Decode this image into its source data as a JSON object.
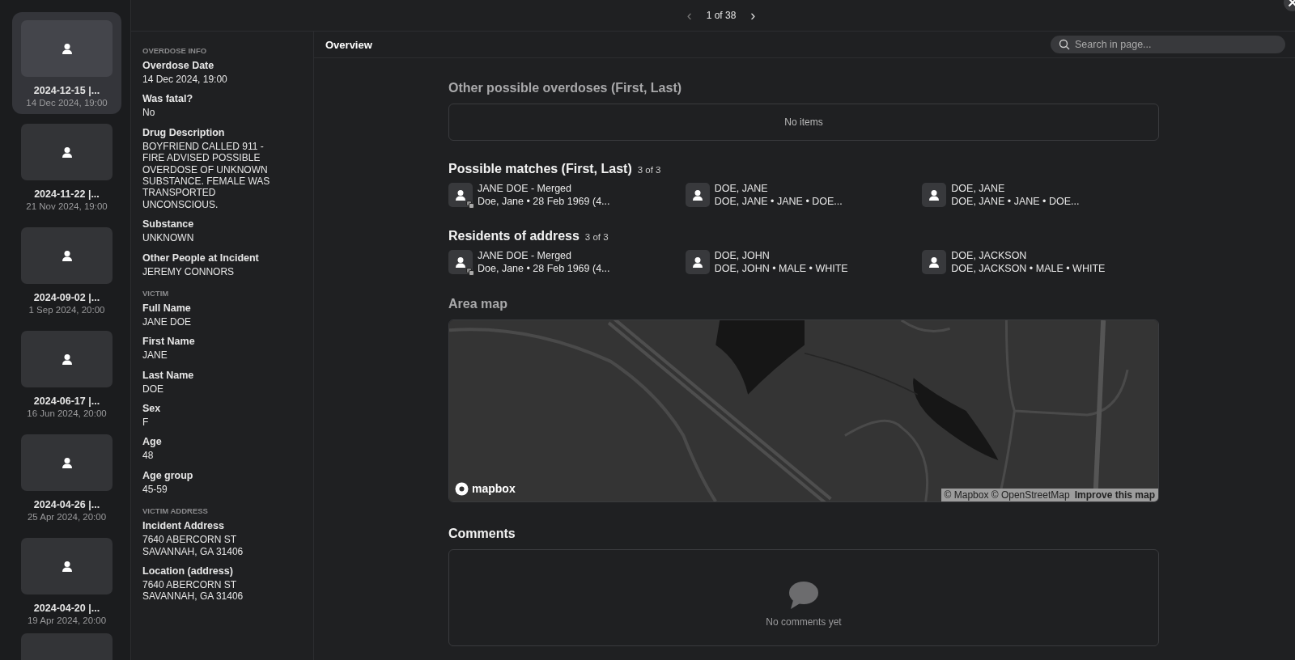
{
  "thumbnails": [
    {
      "title": "2024-12-15 |...",
      "subtitle": "14 Dec 2024, 19:00",
      "selected": true
    },
    {
      "title": "2024-11-22 |...",
      "subtitle": "21 Nov 2024, 19:00",
      "selected": false
    },
    {
      "title": "2024-09-02 |...",
      "subtitle": "1 Sep 2024, 20:00",
      "selected": false
    },
    {
      "title": "2024-06-17 |...",
      "subtitle": "16 Jun 2024, 20:00",
      "selected": false
    },
    {
      "title": "2024-04-26 |...",
      "subtitle": "25 Apr 2024, 20:00",
      "selected": false
    },
    {
      "title": "2024-04-20 |...",
      "subtitle": "19 Apr 2024, 20:00",
      "selected": false
    },
    {
      "kind": "partial"
    }
  ],
  "pager": {
    "prev": "‹",
    "text": "1 of 38",
    "next": "›"
  },
  "details": [
    {
      "section": "OVERDOSE INFO",
      "fields": [
        {
          "label": "Overdose Date",
          "value": "14 Dec 2024, 19:00"
        },
        {
          "label": "Was fatal?",
          "value": "No"
        },
        {
          "label": "Drug Description",
          "value": "BOYFRIEND CALLED 911 - FIRE ADVISED POSSIBLE OVERDOSE OF UNKNOWN SUBSTANCE. FEMALE WAS TRANSPORTED UNCONSCIOUS."
        },
        {
          "label": "Substance",
          "value": "UNKNOWN"
        },
        {
          "label": "Other People at Incident",
          "value": "JEREMY CONNORS"
        }
      ]
    },
    {
      "section": "VICTIM",
      "fields": [
        {
          "label": "Full Name",
          "value": "JANE DOE"
        },
        {
          "label": "First Name",
          "value": "JANE"
        },
        {
          "label": "Last Name",
          "value": "DOE"
        },
        {
          "label": "Sex",
          "value": "F"
        },
        {
          "label": "Age",
          "value": "48"
        },
        {
          "label": "Age group",
          "value": "45-59"
        }
      ]
    },
    {
      "section": "VICTIM ADDRESS",
      "fields": [
        {
          "label": "Incident Address",
          "value": "7640 ABERCORN ST\nSAVANNAH, GA 31406"
        },
        {
          "label": "Location (address)",
          "value": "7640 ABERCORN ST\nSAVANNAH, GA 31406"
        }
      ]
    }
  ],
  "tab": {
    "label": "Overview",
    "selected": true
  },
  "search": {
    "placeholder": "Search in page..."
  },
  "other_overdoses": {
    "title": "Other possible overdoses (First, Last)",
    "empty": "No items"
  },
  "lists": [
    {
      "title": "Possible matches (First, Last)",
      "count": "3 of 3",
      "items": [
        {
          "name": "JANE DOE - Merged",
          "detail": "Doe, Jane • 28 Feb 1969 (4...",
          "merged": true
        },
        {
          "name": "DOE, JANE",
          "detail": "DOE, JANE • JANE • DOE...",
          "merged": false
        },
        {
          "name": "DOE, JANE",
          "detail": "DOE, JANE • JANE • DOE...",
          "merged": false
        }
      ]
    },
    {
      "title": "Residents of address",
      "count": "3 of 3",
      "items": [
        {
          "name": "JANE DOE - Merged",
          "detail": "Doe, Jane • 28 Feb 1969 (4...",
          "merged": true
        },
        {
          "name": "DOE, JOHN",
          "detail": "DOE, JOHN • MALE • WHITE",
          "merged": false
        },
        {
          "name": "DOE, JACKSON",
          "detail": "DOE, JACKSON • MALE • WHITE",
          "merged": false
        }
      ]
    }
  ],
  "map": {
    "title": "Area map",
    "logo": "mapbox",
    "attribution": "© Mapbox © OpenStreetMap",
    "improve": "Improve this map"
  },
  "comments": {
    "title": "Comments",
    "empty": "No comments yet"
  }
}
